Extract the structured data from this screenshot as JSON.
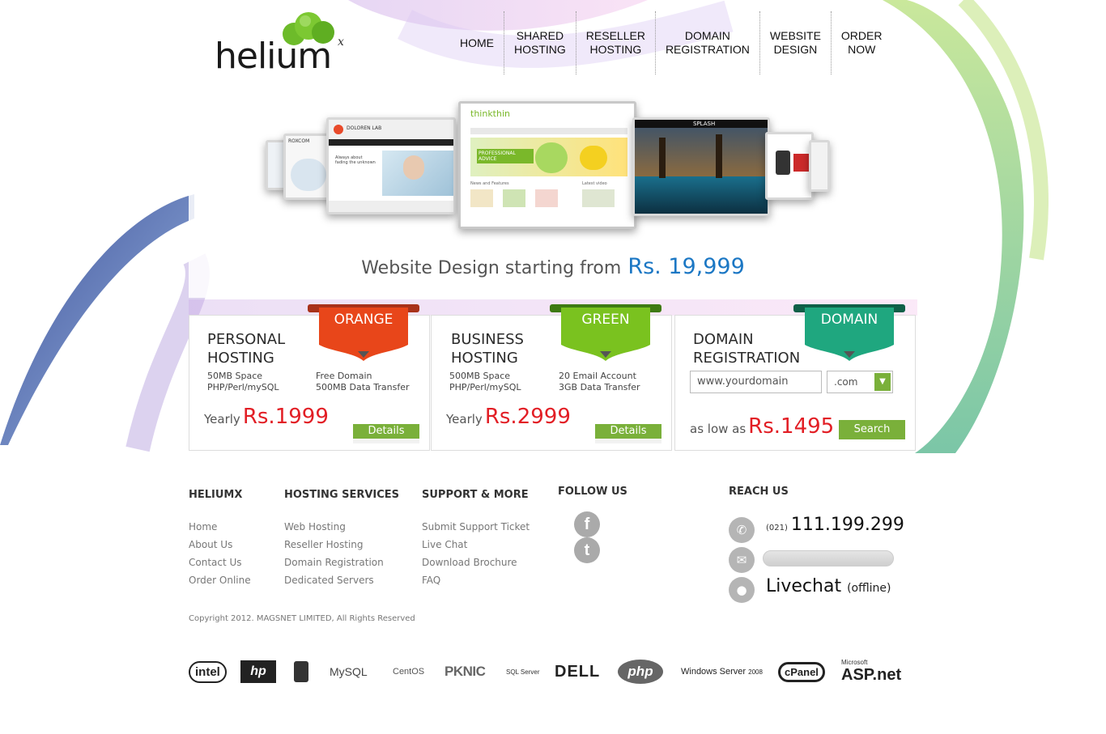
{
  "brand": {
    "logo_text": "helium",
    "logo_sup": "x"
  },
  "nav": [
    {
      "line1": "HOME",
      "line2": ""
    },
    {
      "line1": "SHARED",
      "line2": "HOSTING"
    },
    {
      "line1": "RESELLER",
      "line2": "HOSTING"
    },
    {
      "line1": "DOMAIN",
      "line2": "REGISTRATION"
    },
    {
      "line1": "WEBSITE",
      "line2": "DESIGN"
    },
    {
      "line1": "ORDER",
      "line2": "NOW"
    }
  ],
  "banner": {
    "tagline": "Website Design starting from",
    "price": "Rs. 19,999",
    "screens": {
      "doloren": "DOLOREN LAB",
      "doloren_text": "Always about fading the unknown",
      "thinkthin": "thinkthin",
      "thinkthin_banner": "PROFESSIONAL ADVICE",
      "news": "News and Features",
      "latest": "Latest video",
      "splash": "SPLASH",
      "roxcom": "ROXCOM"
    }
  },
  "plans": {
    "personal": {
      "title_l1": "PERSONAL",
      "title_l2": "HOSTING",
      "ribbon": "ORANGE",
      "feat_left": [
        "50MB Space",
        "PHP/Perl/mySQL"
      ],
      "feat_right": [
        "Free Domain",
        "500MB Data Transfer"
      ],
      "yearly": "Yearly",
      "price": "Rs.1999",
      "button": "Details"
    },
    "business": {
      "title_l1": "BUSINESS",
      "title_l2": "HOSTING",
      "ribbon": "GREEN",
      "feat_left": [
        "500MB Space",
        "PHP/Perl/mySQL"
      ],
      "feat_right": [
        "20 Email Account",
        "3GB Data Transfer"
      ],
      "yearly": "Yearly",
      "price": "Rs.2999",
      "button": "Details"
    },
    "domain": {
      "title_l1": "DOMAIN",
      "title_l2": "REGISTRATION",
      "ribbon": "DOMAIN",
      "input_value": "www.yourdomain",
      "tld": ".com",
      "low_as": "as low as",
      "price": "Rs.1495",
      "button": "Search"
    }
  },
  "footer": {
    "heliumx": {
      "title": "HELIUMX",
      "links": [
        "Home",
        "About Us",
        "Contact Us",
        "Order Online"
      ]
    },
    "hosting": {
      "title": "HOSTING SERVICES",
      "links": [
        "Web Hosting",
        "Reseller Hosting",
        "Domain Registration",
        "Dedicated Servers"
      ]
    },
    "support": {
      "title": "SUPPORT & MORE",
      "links": [
        "Submit Support Ticket",
        "Live Chat",
        "Download Brochure",
        "FAQ"
      ]
    },
    "follow": {
      "title": "FOLLOW US",
      "facebook": "f",
      "twitter": "t"
    },
    "reach": {
      "title": "REACH US",
      "phone_prefix": "(021)",
      "phone": "111.199.299",
      "livechat": "Livechat",
      "livechat_status": "(offline)"
    },
    "copyright": "Copyright 2012. MAGSNET LIMITED, All Rights Reserved"
  },
  "partners": {
    "intel": "intel",
    "hp": "hp",
    "mysql": "MySQL",
    "centos": "CentOS",
    "pknic": "PKNIC",
    "sql": "SQL Server",
    "dell": "DELL",
    "php": "php",
    "windows": "Windows Server",
    "windows_year": "2008",
    "cpanel": "cPanel",
    "aspnet_ms": "Microsoft",
    "aspnet": "ASP.net"
  },
  "colors": {
    "orange": "#e8461a",
    "green": "#7ac21f",
    "teal": "#1fa77f",
    "price_red": "#e21e25",
    "banner_blue": "#1b77c4",
    "button_green": "#7ab03a"
  }
}
